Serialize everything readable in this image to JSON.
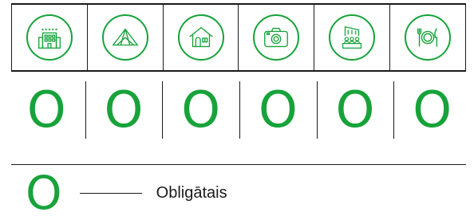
{
  "accent_color": "#17a33a",
  "categories": [
    {
      "icon": "hotel-icon"
    },
    {
      "icon": "tent-icon"
    },
    {
      "icon": "house-icon"
    },
    {
      "icon": "camera-icon"
    },
    {
      "icon": "conference-icon"
    },
    {
      "icon": "dining-icon"
    }
  ],
  "marks": [
    "O",
    "O",
    "O",
    "O",
    "O",
    "O"
  ],
  "legend": {
    "symbol": "O",
    "label": "Obligātais"
  }
}
